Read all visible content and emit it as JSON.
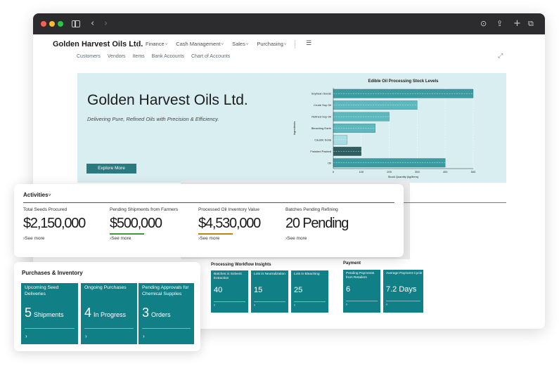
{
  "app": {
    "company_name": "Golden Harvest Oils Ltd.",
    "menu": [
      {
        "label": "Finance",
        "chevron": "˅"
      },
      {
        "label": "Cash Management",
        "chevron": "˅"
      },
      {
        "label": "Sales",
        "chevron": "˅"
      },
      {
        "label": "Purchasing",
        "chevron": "˅"
      }
    ],
    "subnav": [
      "Customers",
      "Vendors",
      "Items",
      "Bank Accounts",
      "Chart of Accounts"
    ]
  },
  "hero": {
    "title": "Golden Harvest Oils Ltd.",
    "subtitle": "Delivering Pure, Refined Oils with Precision & Efficiency.",
    "button_label": "Explore More",
    "background": "#d9eef0"
  },
  "chart_data": {
    "type": "bar",
    "orientation": "horizontal",
    "title": "Edible Oil Processing Stock Levels",
    "xlabel": "Stock Quantity (kg/liters)",
    "ylabel": "Ingredients",
    "categories": [
      "Soybean Seeds",
      "Crude Soy Oil",
      "Refined Soy Oil",
      "Bleaching Earth",
      "Caustic Soda",
      "Finished Packed",
      "Oil"
    ],
    "values": [
      500,
      300,
      200,
      150,
      50,
      100,
      400
    ],
    "colors": [
      "#3a9ba1",
      "#5db8bd",
      "#5db8bd",
      "#5db8bd",
      "#a6dde0",
      "#2e5e60",
      "#3a9ba1"
    ],
    "xlim": [
      0,
      500
    ],
    "xticks": [
      0,
      100,
      200,
      300,
      400,
      500
    ],
    "grid": true
  },
  "activities": {
    "title": "Activities",
    "chevron": "˅",
    "kpis": [
      {
        "label": "Total Seeds Procured",
        "value": "$2,150,000",
        "see_more": "See more",
        "bar_color": ""
      },
      {
        "label": "Pending Shipments from Farmers",
        "value": "$500,000",
        "see_more": "See more",
        "bar_color": "#3a9a3a"
      },
      {
        "label": "Processed Oil Inventory Value",
        "value": "$4,530,000",
        "see_more": "See more",
        "bar_color": "#b8860b"
      },
      {
        "label": "Batches Pending Refining",
        "value": "20 Pending",
        "see_more": "See more",
        "bar_color": ""
      }
    ]
  },
  "purchases": {
    "title": "Purchases & Inventory",
    "tiles": [
      {
        "label": "Upcoming Seed Deliveries",
        "value": "5",
        "unit": "Shipments"
      },
      {
        "label": "Ongoing Purchases",
        "value": "4",
        "unit": "In Progress"
      },
      {
        "label": "Pending Approvals for Chemical Supplies",
        "value": "3",
        "unit": "Orders"
      }
    ]
  },
  "workflow": {
    "title": "Processing Workflow Insights",
    "tiles": [
      {
        "label": "Batches in Solvent Extraction",
        "value": "40"
      },
      {
        "label": "Lots in Neutralization",
        "value": "15"
      },
      {
        "label": "Lots in Bleaching",
        "value": "25"
      }
    ]
  },
  "payment": {
    "title": "Payment",
    "tiles": [
      {
        "label": "Pending Payments from Retailers",
        "value": "6"
      },
      {
        "label": "Average Payment Cycle",
        "value": "7.2 Days"
      }
    ]
  },
  "colors": {
    "accent": "#107f86",
    "button": "#2b7a80"
  },
  "icons": {
    "arrow": "›",
    "see_more_arrow": "›"
  }
}
